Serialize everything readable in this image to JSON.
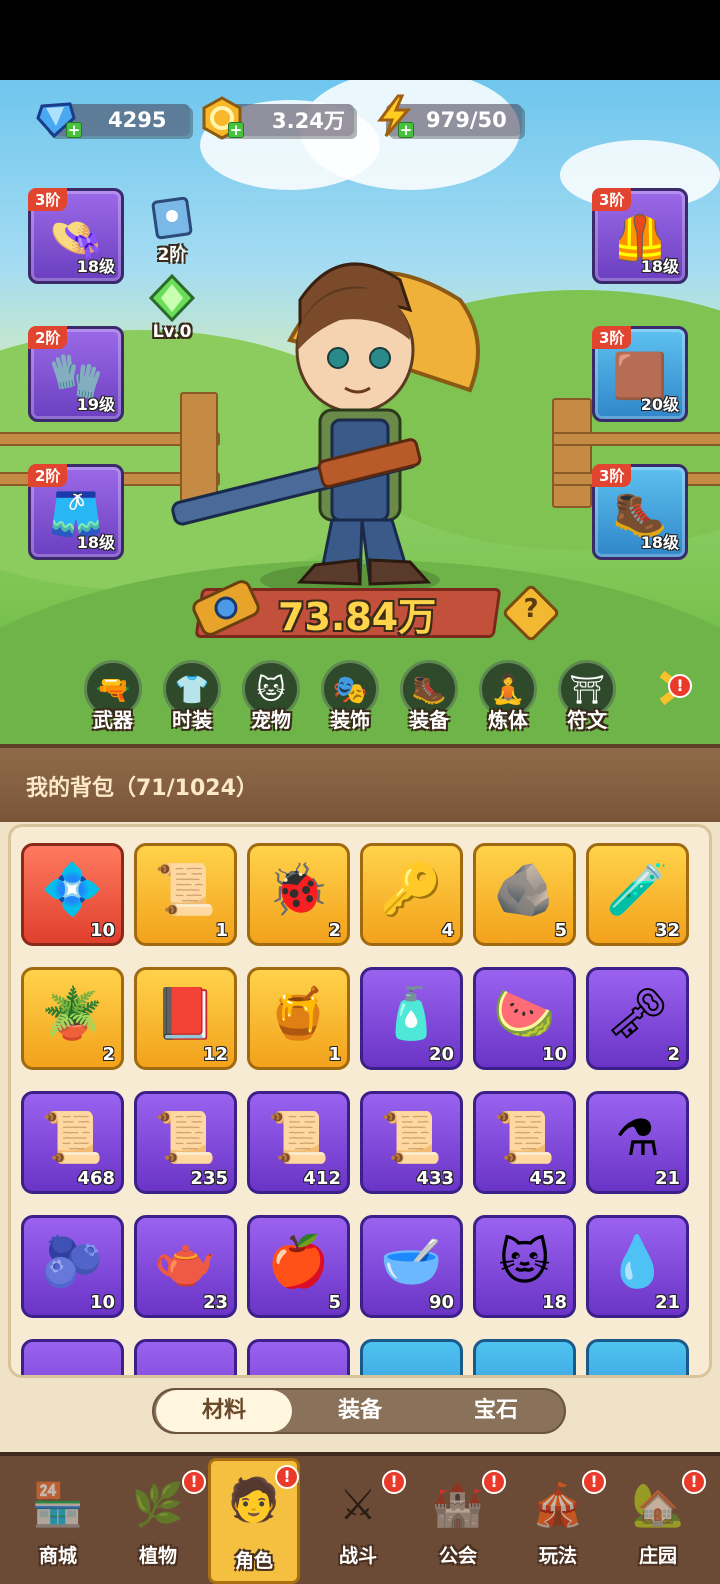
{
  "resources": {
    "gems": "4295",
    "gold": "3.24万",
    "energy": "979/50"
  },
  "equip_left": [
    {
      "tier": "3阶",
      "level": "18级",
      "icon": "straw-hat-icon",
      "glyph": "👒"
    },
    {
      "tier": "2阶",
      "level": "19级",
      "icon": "glove-icon",
      "glyph": "🧤"
    },
    {
      "tier": "2阶",
      "level": "18级",
      "icon": "shorts-icon",
      "glyph": "🩳"
    }
  ],
  "equip_right": [
    {
      "tier": "3阶",
      "level": "18级",
      "icon": "overalls-icon",
      "glyph": "🦺"
    },
    {
      "tier": "3阶",
      "level": "20级",
      "icon": "belt-icon",
      "glyph": "🟫"
    },
    {
      "tier": "3阶",
      "level": "18级",
      "icon": "boots-icon",
      "glyph": "🥾"
    }
  ],
  "pet_badge": {
    "label": "2阶",
    "icon": "pet-scroll-icon"
  },
  "gem_badge": {
    "label": "Lv.0",
    "icon": "green-gem-icon"
  },
  "power": {
    "value": "73.84万",
    "help": "?"
  },
  "feature_tabs": [
    {
      "label": "武器",
      "icon": "weapon-icon",
      "glyph": "🔫"
    },
    {
      "label": "时装",
      "icon": "costume-icon",
      "glyph": "👕"
    },
    {
      "label": "宠物",
      "icon": "pet-icon",
      "glyph": "🐱"
    },
    {
      "label": "装饰",
      "icon": "mask-icon",
      "glyph": "🎭"
    },
    {
      "label": "装备",
      "icon": "equipment-icon",
      "glyph": "🥾"
    },
    {
      "label": "炼体",
      "icon": "body-training-icon",
      "glyph": "🧘"
    },
    {
      "label": "符文",
      "icon": "rune-icon",
      "glyph": "⛩"
    }
  ],
  "bag": {
    "title": "我的背包（71/1024）",
    "items": [
      {
        "count": "10",
        "color": "red",
        "icon": "star-crystal-icon",
        "glyph": "💠"
      },
      {
        "count": "1",
        "color": "gold",
        "icon": "skull-scroll-icon",
        "glyph": "📜"
      },
      {
        "count": "2",
        "color": "gold",
        "icon": "golden-bug-icon",
        "glyph": "🐞"
      },
      {
        "count": "4",
        "color": "gold",
        "icon": "golden-key-icon",
        "glyph": "🔑"
      },
      {
        "count": "5",
        "color": "gold",
        "icon": "rune-stone-icon",
        "glyph": "🪨"
      },
      {
        "count": "32",
        "color": "gold",
        "icon": "orange-potion-icon",
        "glyph": "🧪"
      },
      {
        "count": "2",
        "color": "gold",
        "icon": "flower-pot-icon",
        "glyph": "🪴"
      },
      {
        "count": "12",
        "color": "gold",
        "icon": "spell-book-icon",
        "glyph": "📕"
      },
      {
        "count": "1",
        "color": "gold",
        "icon": "honey-jar-icon",
        "glyph": "🍯"
      },
      {
        "count": "20",
        "color": "purp",
        "icon": "purple-potion-icon",
        "glyph": "🧴"
      },
      {
        "count": "10",
        "color": "purp",
        "icon": "watermelon-icon",
        "glyph": "🍉"
      },
      {
        "count": "2",
        "color": "purp",
        "icon": "silver-key-icon",
        "glyph": "🗝"
      },
      {
        "count": "468",
        "color": "purp",
        "icon": "scroll-green-icon",
        "glyph": "📜"
      },
      {
        "count": "235",
        "color": "purp",
        "icon": "scroll-purple-icon",
        "glyph": "📜"
      },
      {
        "count": "412",
        "color": "purp",
        "icon": "scroll-blue-icon",
        "glyph": "📜"
      },
      {
        "count": "433",
        "color": "purp",
        "icon": "scroll-fire-icon",
        "glyph": "📜"
      },
      {
        "count": "452",
        "color": "purp",
        "icon": "scroll-lightning-icon",
        "glyph": "📜"
      },
      {
        "count": "21",
        "color": "purp",
        "icon": "purple-flask-icon",
        "glyph": "⚗"
      },
      {
        "count": "10",
        "color": "purp",
        "icon": "blue-bud-icon",
        "glyph": "🫐"
      },
      {
        "count": "23",
        "color": "purp",
        "icon": "watering-can-icon",
        "glyph": "🫖"
      },
      {
        "count": "5",
        "color": "purp",
        "icon": "fruit-bowl-icon",
        "glyph": "🍎"
      },
      {
        "count": "90",
        "color": "purp",
        "icon": "pet-food-bowl-icon",
        "glyph": "🥣"
      },
      {
        "count": "18",
        "color": "purp",
        "icon": "blue-cat-icon",
        "glyph": "🐱"
      },
      {
        "count": "21",
        "color": "purp",
        "icon": "golden-drop-icon",
        "glyph": "💧"
      },
      {
        "count": "",
        "color": "purp",
        "icon": "partial-item-icon",
        "glyph": ""
      },
      {
        "count": "",
        "color": "purp",
        "icon": "partial-item-icon",
        "glyph": ""
      },
      {
        "count": "",
        "color": "purp",
        "icon": "partial-item-icon",
        "glyph": ""
      },
      {
        "count": "",
        "color": "blu",
        "icon": "partial-item-icon",
        "glyph": ""
      },
      {
        "count": "",
        "color": "blu",
        "icon": "partial-item-icon",
        "glyph": ""
      },
      {
        "count": "",
        "color": "blu",
        "icon": "partial-item-icon",
        "glyph": ""
      }
    ]
  },
  "bag_tabs": [
    "材料",
    "装备",
    "宝石"
  ],
  "bottom_nav": [
    {
      "label": "商城",
      "icon": "shop-icon",
      "glyph": "🏪",
      "badge": false
    },
    {
      "label": "植物",
      "icon": "plant-icon",
      "glyph": "🌿",
      "badge": true
    },
    {
      "label": "角色",
      "icon": "character-icon",
      "glyph": "🧑",
      "badge": true,
      "active": true
    },
    {
      "label": "战斗",
      "icon": "battle-icon",
      "glyph": "⚔",
      "badge": true
    },
    {
      "label": "公会",
      "icon": "guild-icon",
      "glyph": "🏰",
      "badge": true
    },
    {
      "label": "玩法",
      "icon": "gameplay-icon",
      "glyph": "🎪",
      "badge": true
    },
    {
      "label": "庄园",
      "icon": "manor-icon",
      "glyph": "🏡",
      "badge": true
    }
  ]
}
